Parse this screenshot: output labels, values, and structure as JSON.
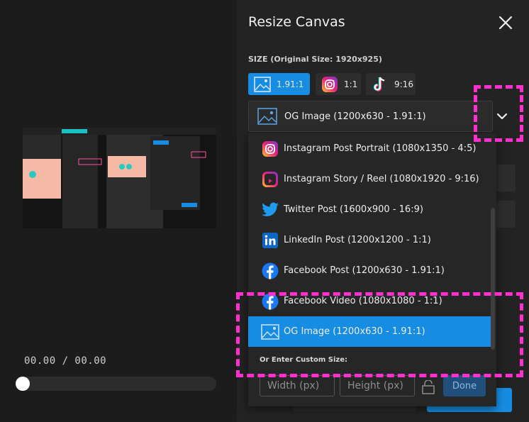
{
  "player": {
    "time": "00.00 / 00.00"
  },
  "panel": {
    "title": "Resize Canvas",
    "size_label": "SIZE (Original Size: 1920x925)",
    "presets": [
      {
        "label": "1.91:1",
        "icon": "image-icon",
        "active": true
      },
      {
        "label": "1:1",
        "icon": "instagram-icon",
        "active": false
      },
      {
        "label": "9:16",
        "icon": "tiktok-icon",
        "active": false
      }
    ],
    "select_value": "OG Image (1200x630 - 1.91:1)",
    "options": [
      {
        "label": "Instagram Post Portrait (1080x1350 - 4:5)",
        "icon": "instagram-icon"
      },
      {
        "label": "Instagram Story / Reel (1080x1920 - 9:16)",
        "icon": "instagram-reel-icon"
      },
      {
        "label": "Twitter Post (1600x900 - 16:9)",
        "icon": "twitter-icon"
      },
      {
        "label": "LinkedIn Post (1200x1200 - 1:1)",
        "icon": "linkedin-icon"
      },
      {
        "label": "Facebook Post (1200x630 - 1.91:1)",
        "icon": "facebook-icon"
      },
      {
        "label": "Facebook Video (1080x1080 - 1:1)",
        "icon": "facebook-icon"
      },
      {
        "label": "OG Image (1200x630 - 1.91:1)",
        "icon": "image-icon",
        "selected": true
      }
    ],
    "custom_label": "Or Enter Custom Size:",
    "width_placeholder": "Width (px)",
    "height_placeholder": "Height (px)",
    "done_label": "Done"
  },
  "colors": {
    "accent": "#168de2",
    "highlight": "#ff2fd0"
  }
}
